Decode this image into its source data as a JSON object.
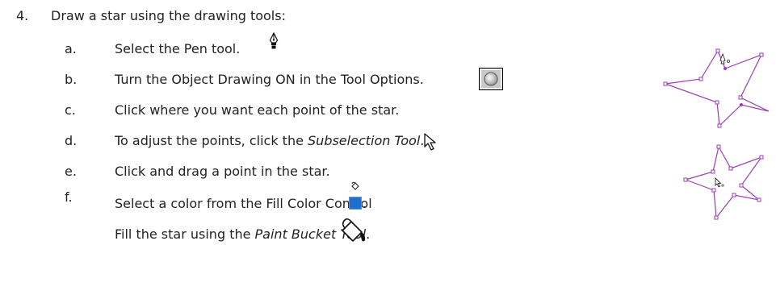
{
  "step": {
    "number": "4.",
    "title": "Draw a star using the drawing tools:"
  },
  "substeps": [
    {
      "letter": "a.",
      "text": "Select the Pen tool."
    },
    {
      "letter": "b.",
      "text": "Turn the Object Drawing ON in the Tool Options."
    },
    {
      "letter": "c.",
      "text": "Click where you want each point of the star."
    },
    {
      "letter": "d.",
      "text_before": "To adjust the points, click the ",
      "text_em": "Subselection Tool",
      "text_after": "."
    },
    {
      "letter": "e.",
      "text": "Click and drag a point in the star."
    },
    {
      "letter": "f.",
      "text": "Select a color from the Fill Color Control"
    },
    {
      "letter": "",
      "text_before": "Fill the star using the ",
      "text_em": "Paint Bucket Tool",
      "text_after": "."
    }
  ],
  "icons": {
    "pen": "pen-tool-icon",
    "object_drawing": "object-drawing-icon",
    "subselection": "subselection-arrow-icon",
    "fill_color": "fill-color-control-icon",
    "paint_bucket": "paint-bucket-icon",
    "star_pen": "star-pen-illustration",
    "star_subselect": "star-subselection-illustration"
  },
  "colors": {
    "text": "#222222",
    "star_stroke": "#9a3fb0",
    "fill_swatch": "#1f6fd1"
  },
  "punct": {
    "period": "."
  }
}
